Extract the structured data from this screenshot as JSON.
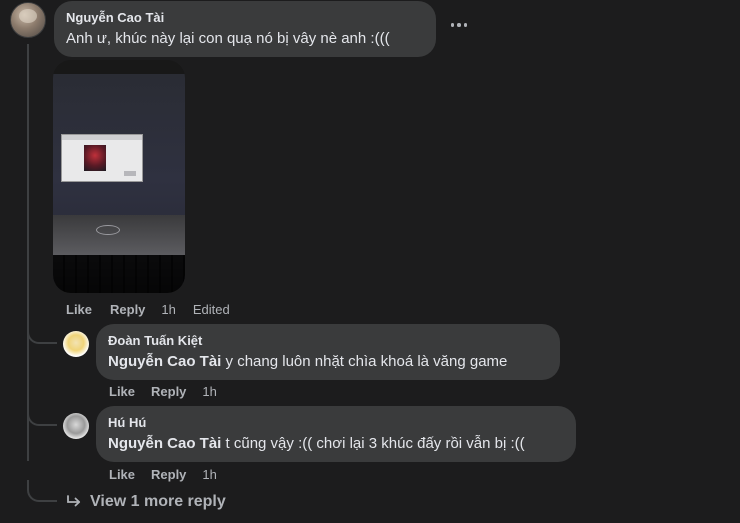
{
  "main_comment": {
    "author": "Nguyễn Cao Tài",
    "text": "Anh ư, khúc này lại con quạ nó bị vây nè anh :(((",
    "actions": {
      "like": "Like",
      "reply": "Reply",
      "time": "1h",
      "edited": "Edited"
    }
  },
  "replies": [
    {
      "author": "Đoàn Tuấn Kiệt",
      "mention": "Nguyễn Cao Tài",
      "text": "y chang luôn nhặt chìa khoá là văng game",
      "actions": {
        "like": "Like",
        "reply": "Reply",
        "time": "1h"
      }
    },
    {
      "author": "Hú Hú",
      "mention": "Nguyễn Cao Tài",
      "text": "t cũng vậy :(( chơi lại 3 khúc đấy rồi vẫn bị :((",
      "actions": {
        "like": "Like",
        "reply": "Reply",
        "time": "1h"
      }
    }
  ],
  "view_more": {
    "label": "View 1 more reply",
    "icon": "reply-arrow-icon"
  },
  "colors": {
    "background": "#1c1c1d",
    "bubble": "#3a3b3c",
    "text_primary": "#e4e6eb",
    "text_secondary": "#b0b3b8"
  }
}
